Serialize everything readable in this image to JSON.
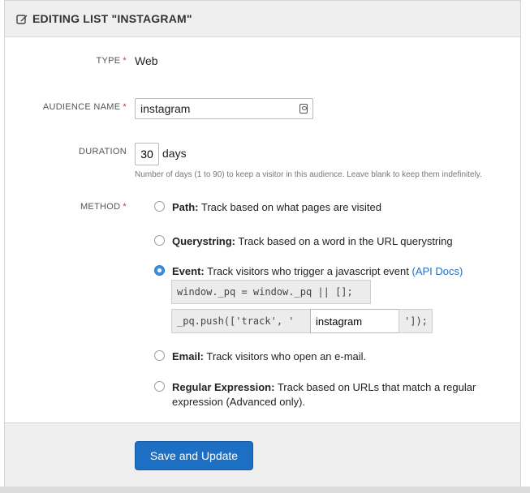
{
  "header": {
    "title": "EDITING LIST \"INSTAGRAM\"",
    "icon": "edit-icon"
  },
  "form": {
    "type": {
      "label": "TYPE",
      "value": "Web"
    },
    "audience_name": {
      "label": "AUDIENCE NAME",
      "value": "instagram"
    },
    "duration": {
      "label": "DURATION",
      "value": "30",
      "unit": "days",
      "help": "Number of days (1 to 90) to keep a visitor in this audience. Leave blank to keep them indefinitely."
    },
    "method": {
      "label": "METHOD",
      "options": [
        {
          "title": "Path:",
          "desc": " Track based on what pages are visited",
          "checked": false
        },
        {
          "title": "Querystring:",
          "desc": " Track based on a word in the URL querystring",
          "checked": false
        },
        {
          "title": "Event:",
          "desc": " Track visitors who trigger a javascript event ",
          "link": "(API Docs)",
          "checked": true
        },
        {
          "title": "Email:",
          "desc": " Track visitors who open an e-mail.",
          "checked": false
        },
        {
          "title": "Regular Expression:",
          "desc": " Track based on URLs that match a regular expression (Advanced only).",
          "checked": false
        }
      ],
      "event_code": {
        "line1": "window._pq = window._pq || [];",
        "line2_prefix": "_pq.push(['track', '",
        "event_value": "instagram",
        "line2_suffix": "']);"
      }
    }
  },
  "footer": {
    "save_label": "Save and Update"
  }
}
